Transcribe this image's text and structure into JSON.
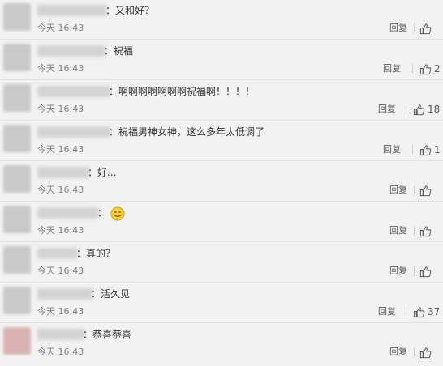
{
  "comments": [
    {
      "text": "：又和好？",
      "time": "今天 16:43",
      "reply": "回复",
      "likes": ""
    },
    {
      "text": "：祝福",
      "time": "今天 16:43",
      "reply": "回复",
      "likes": "2"
    },
    {
      "text": "：啊啊啊啊啊啊啊祝福啊！！！！",
      "time": "今天 16:43",
      "reply": "回复",
      "likes": "18"
    },
    {
      "text": "：祝福男神女神，这么多年太低调了",
      "time": "今天 16:43",
      "reply": "回复",
      "likes": "1"
    },
    {
      "text": "：好...",
      "time": "今天 16:43",
      "reply": "回复",
      "likes": ""
    },
    {
      "text": "：",
      "emoji": "smile-emoji",
      "time": "今天 16:43",
      "reply": "回复",
      "likes": ""
    },
    {
      "text": "：真的？",
      "time": "今天 16:43",
      "reply": "回复",
      "likes": ""
    },
    {
      "text": "：活久见",
      "time": "今天 16:43",
      "reply": "回复",
      "likes": "37"
    },
    {
      "text": "：恭喜恭喜",
      "time": "今天 16:43",
      "reply": "回复",
      "likes": ""
    }
  ],
  "icons": {
    "like": "thumbs-up-icon"
  },
  "colors": {
    "background": "#f2f2f2",
    "text": "#333333",
    "meta": "#808080"
  }
}
